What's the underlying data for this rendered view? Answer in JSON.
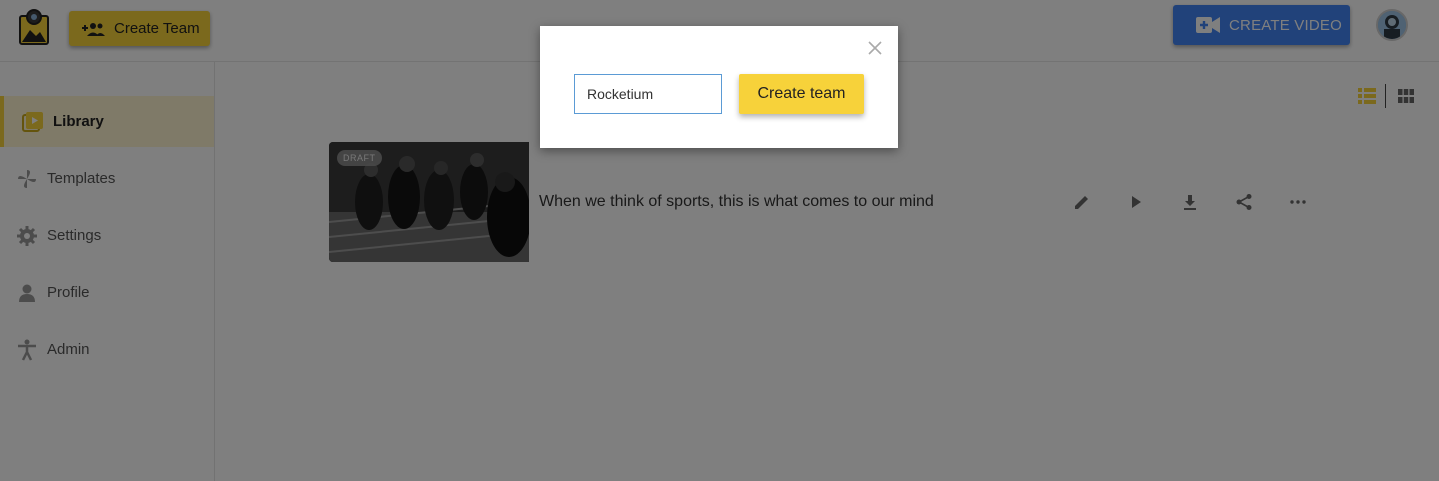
{
  "header": {
    "create_team_label": "Create Team",
    "create_video_label": "CREATE VIDEO"
  },
  "sidebar": {
    "items": [
      {
        "label": "Library",
        "icon": "library-icon"
      },
      {
        "label": "Templates",
        "icon": "pinwheel-icon"
      },
      {
        "label": "Settings",
        "icon": "gear-icon"
      },
      {
        "label": "Profile",
        "icon": "person-icon"
      },
      {
        "label": "Admin",
        "icon": "accessibility-icon"
      }
    ]
  },
  "video_card": {
    "badge": "DRAFT",
    "title": "When we think of sports, this is what comes to our mind",
    "actions": [
      "edit-icon",
      "play-icon",
      "download-icon",
      "share-icon",
      "more-icon"
    ]
  },
  "modal": {
    "input_value": "Rocketium",
    "create_button_label": "Create team"
  },
  "colors": {
    "accent_yellow": "#f7d23a",
    "accent_blue": "#4285f4",
    "overlay": "rgba(0,0,0,0.5)"
  }
}
